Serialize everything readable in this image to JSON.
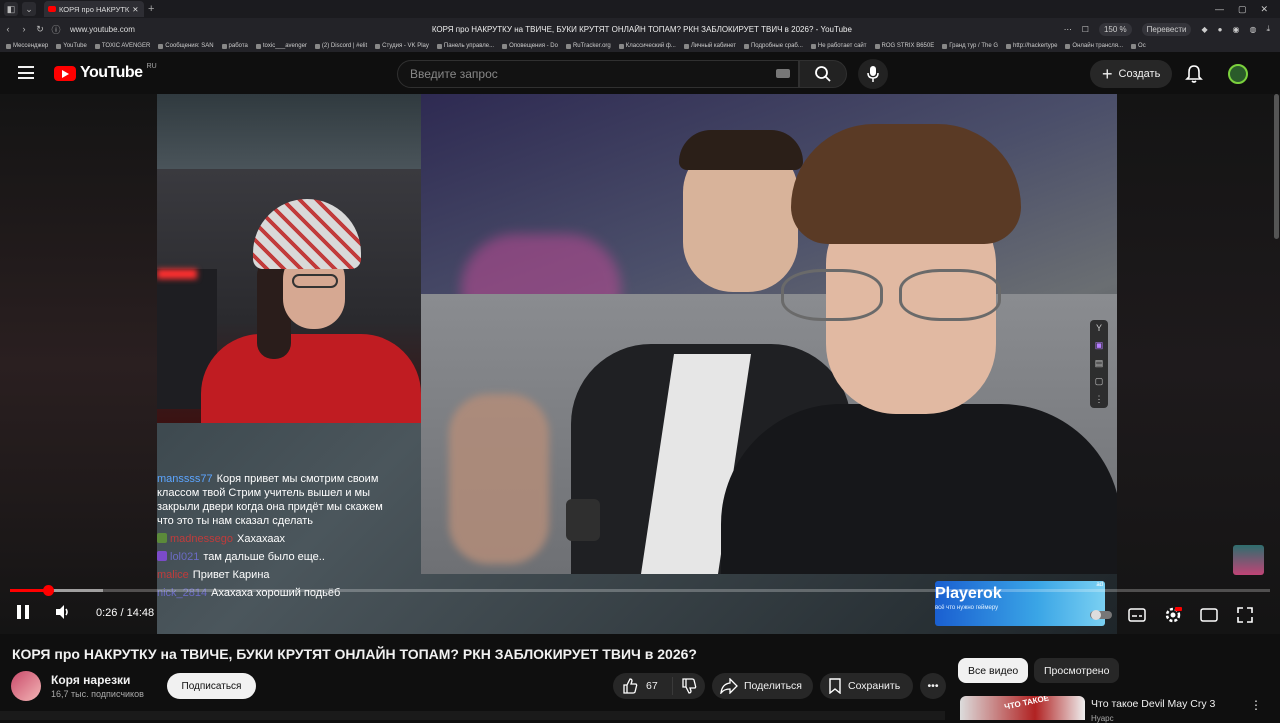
{
  "browser": {
    "tab_title": "КОРЯ про НАКРУТК",
    "url": "www.youtube.com",
    "page_title": "КОРЯ про НАКРУТКУ на ТВИЧЕ, БУКИ КРУТЯТ ОНЛАЙН ТОПАМ? РКН ЗАБЛОКИРУЕТ ТВИЧ в 2026? - YouTube",
    "zoom": "150 %",
    "translate_label": "Перевести",
    "bookmarks": [
      "Мессенджер",
      "YouTube",
      "TOXIC AVENGER",
      "Сообщения: SAN",
      "работа",
      "toxic___avenger",
      "(2) Discord | #elit",
      "Студия - VK Play",
      "Панель управле...",
      "Оповещения - Do",
      "RuTracker.org",
      "Классический ф...",
      "Личный кабинет",
      "Подробные сраб...",
      "Не работает сайт",
      "ROG STRIX B650E",
      "Гранд тур / The G",
      "http://hackertype",
      "Онлайн трансля...",
      "Ос"
    ]
  },
  "header": {
    "logo_text": "YouTube",
    "logo_region": "RU",
    "search_placeholder": "Введите запрос",
    "create_label": "Создать"
  },
  "player": {
    "time_current": "0:26",
    "time_total": "14:48",
    "progress_fraction": 0.03,
    "chat": [
      {
        "user": "manssss77",
        "text": "Коря привет мы смотрим своим классом твой Стрим учитель вышел и мы закрыли двери когда она придёт мы скажем что это ты нам сказал сделать"
      },
      {
        "user": "madnessego",
        "text": "Хахахаах"
      },
      {
        "user": "lol021",
        "text": "там дальше было еще.."
      },
      {
        "user": "malice",
        "text": "Привет Карина"
      },
      {
        "user": "nick_2814",
        "text": "Ахахаха хороший подьёб"
      }
    ],
    "ad": {
      "title": "Playerok",
      "subtitle": "всё что нужно геймеру",
      "tag": "ad"
    }
  },
  "video": {
    "title": "КОРЯ про НАКРУТКУ на ТВИЧЕ, БУКИ КРУТЯТ ОНЛАЙН ТОПАМ? РКН ЗАБЛОКИРУЕТ ТВИЧ в 2026?",
    "channel_name": "Коря нарезки",
    "channel_subs": "16,7 тыс. подписчиков",
    "subscribe_label": "Подписаться",
    "likes": "67",
    "share_label": "Поделиться",
    "save_label": "Сохранить"
  },
  "sidebar": {
    "chips": [
      "Все видео",
      "Просмотрено"
    ],
    "rec": {
      "title": "Что такое Devil May Cry 3",
      "channel": "Нуарс",
      "thumb_text": "ЧТО ТАКОЕ"
    }
  }
}
